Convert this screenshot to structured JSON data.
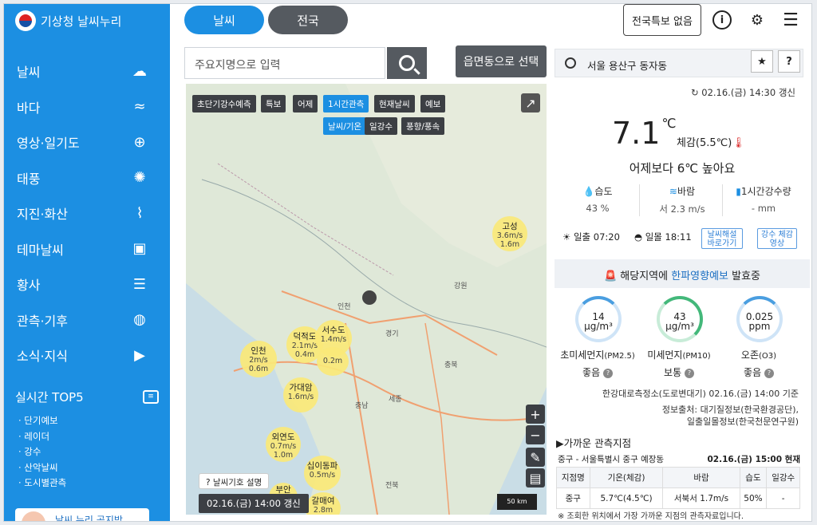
{
  "sidebar": {
    "brand": "기상청 날씨누리",
    "items": [
      {
        "label": "날씨",
        "icon": "☁"
      },
      {
        "label": "바다",
        "icon": "≈"
      },
      {
        "label": "영상·일기도",
        "icon": "⊕"
      },
      {
        "label": "태풍",
        "icon": "✺"
      },
      {
        "label": "지진·화산",
        "icon": "⌇"
      },
      {
        "label": "테마날씨",
        "icon": "▣"
      },
      {
        "label": "황사",
        "icon": "☰"
      },
      {
        "label": "관측·기후",
        "icon": "◍"
      },
      {
        "label": "소식·지식",
        "icon": "▶"
      }
    ],
    "top5_title": "실시간 TOP5",
    "top5": [
      "· 단기예보",
      "· 레이더",
      "· 강수",
      "· 산악날씨",
      "· 도시별관측"
    ],
    "banner": "날씨 누리  공지방"
  },
  "center": {
    "tab_weather": "날씨",
    "tab_national": "전국",
    "search_placeholder": "주요지명으로 입력",
    "region_button": "읍면동으로 선택"
  },
  "map": {
    "chips": [
      "초단기강수예측",
      "특보",
      "어제",
      "1시간관측",
      "현재날씨",
      "예보"
    ],
    "subchips": [
      "날씨/기온",
      "일강수",
      "풍향/풍속"
    ],
    "labels": [
      "강원",
      "인천",
      "경기",
      "충북",
      "세종",
      "충남",
      "전북",
      "서울"
    ],
    "bubbles": [
      {
        "name": "고성",
        "v1": "3.6m/s",
        "v2": "1.6m"
      },
      {
        "name": "덕적도",
        "v1": "2.1m/s",
        "v2": "0.4m"
      },
      {
        "name": "서수도",
        "v1": "1.4m/s",
        "v2": ""
      },
      {
        "name": "인천",
        "v1": "2m/s",
        "v2": "0.6m"
      },
      {
        "name": "",
        "v1": "0.2m",
        "v2": ""
      },
      {
        "name": "가대암",
        "v1": "1.6m/s",
        "v2": ""
      },
      {
        "name": "외연도",
        "v1": "0.7m/s",
        "v2": "1.0m"
      },
      {
        "name": "십이동파",
        "v1": "0.5m/s",
        "v2": ""
      },
      {
        "name": "갈매여",
        "v1": "2.8m",
        "v2": ""
      },
      {
        "name": "부안",
        "v1": "",
        "v2": ""
      }
    ],
    "help": "날씨기호 설명",
    "stamp": "02.16.(금) 14:00 갱신",
    "scale": "50 km",
    "zoom_in": "+",
    "zoom_out": "−"
  },
  "right": {
    "notice": "전국특보 없음",
    "location": "서울 용산구 동자동",
    "updated": "02.16.(금) 14:30 갱신",
    "temperature": "7.1",
    "temp_unit": "℃",
    "feels_like": "체감(5.5℃)",
    "compare": "어제보다 6℃ 높아요",
    "humidity_label": "습도",
    "humidity": "43 %",
    "wind_label": "바람",
    "wind": "서 2.3 m/s",
    "rain_label": "1시간강수량",
    "rain": "- mm",
    "sunrise_label": "일출",
    "sunrise": "07:20",
    "sunset_label": "일몰",
    "sunset": "18:11",
    "btn_weather": "날씨해설 바로가기",
    "btn_rain": "강수 체감영상",
    "alert_pre": "해당지역에 ",
    "alert_hl": "한파영향예보",
    "alert_post": " 발효중",
    "air": [
      {
        "value": "14",
        "unit": "μg/m³",
        "name": "초미세먼지",
        "sub": "(PM2.5)",
        "grade": "좋음",
        "color": "#4a9ee0"
      },
      {
        "value": "43",
        "unit": "μg/m³",
        "name": "미세먼지",
        "sub": "(PM10)",
        "grade": "보통",
        "color": "#43b87a"
      },
      {
        "value": "0.025",
        "unit": "ppm",
        "name": "오존",
        "sub": "(O3)",
        "grade": "좋음",
        "color": "#4a9ee0"
      }
    ],
    "air_source": "한강대로측정소(도로변대기) 02.16.(금) 14:00 기준",
    "info_source1": "정보출처: 대기질정보(한국환경공단),",
    "info_source2": "일출일몰정보(한국천문연구원)",
    "near_title": "▶가까운 관측지점",
    "near_place": "중구 - 서울특별시 중구 예장동",
    "near_time": "02.16.(금) 15:00 현재",
    "table_head": [
      "지점명",
      "기온(체감)",
      "바람",
      "습도",
      "일강수"
    ],
    "table_row": [
      "중구",
      "5.7℃(4.5℃)",
      "서북서 1.7m/s",
      "50%",
      "-"
    ],
    "footnote": "※ 조회한 위치에서 가장 가까운 지점의 관측자료입니다."
  }
}
